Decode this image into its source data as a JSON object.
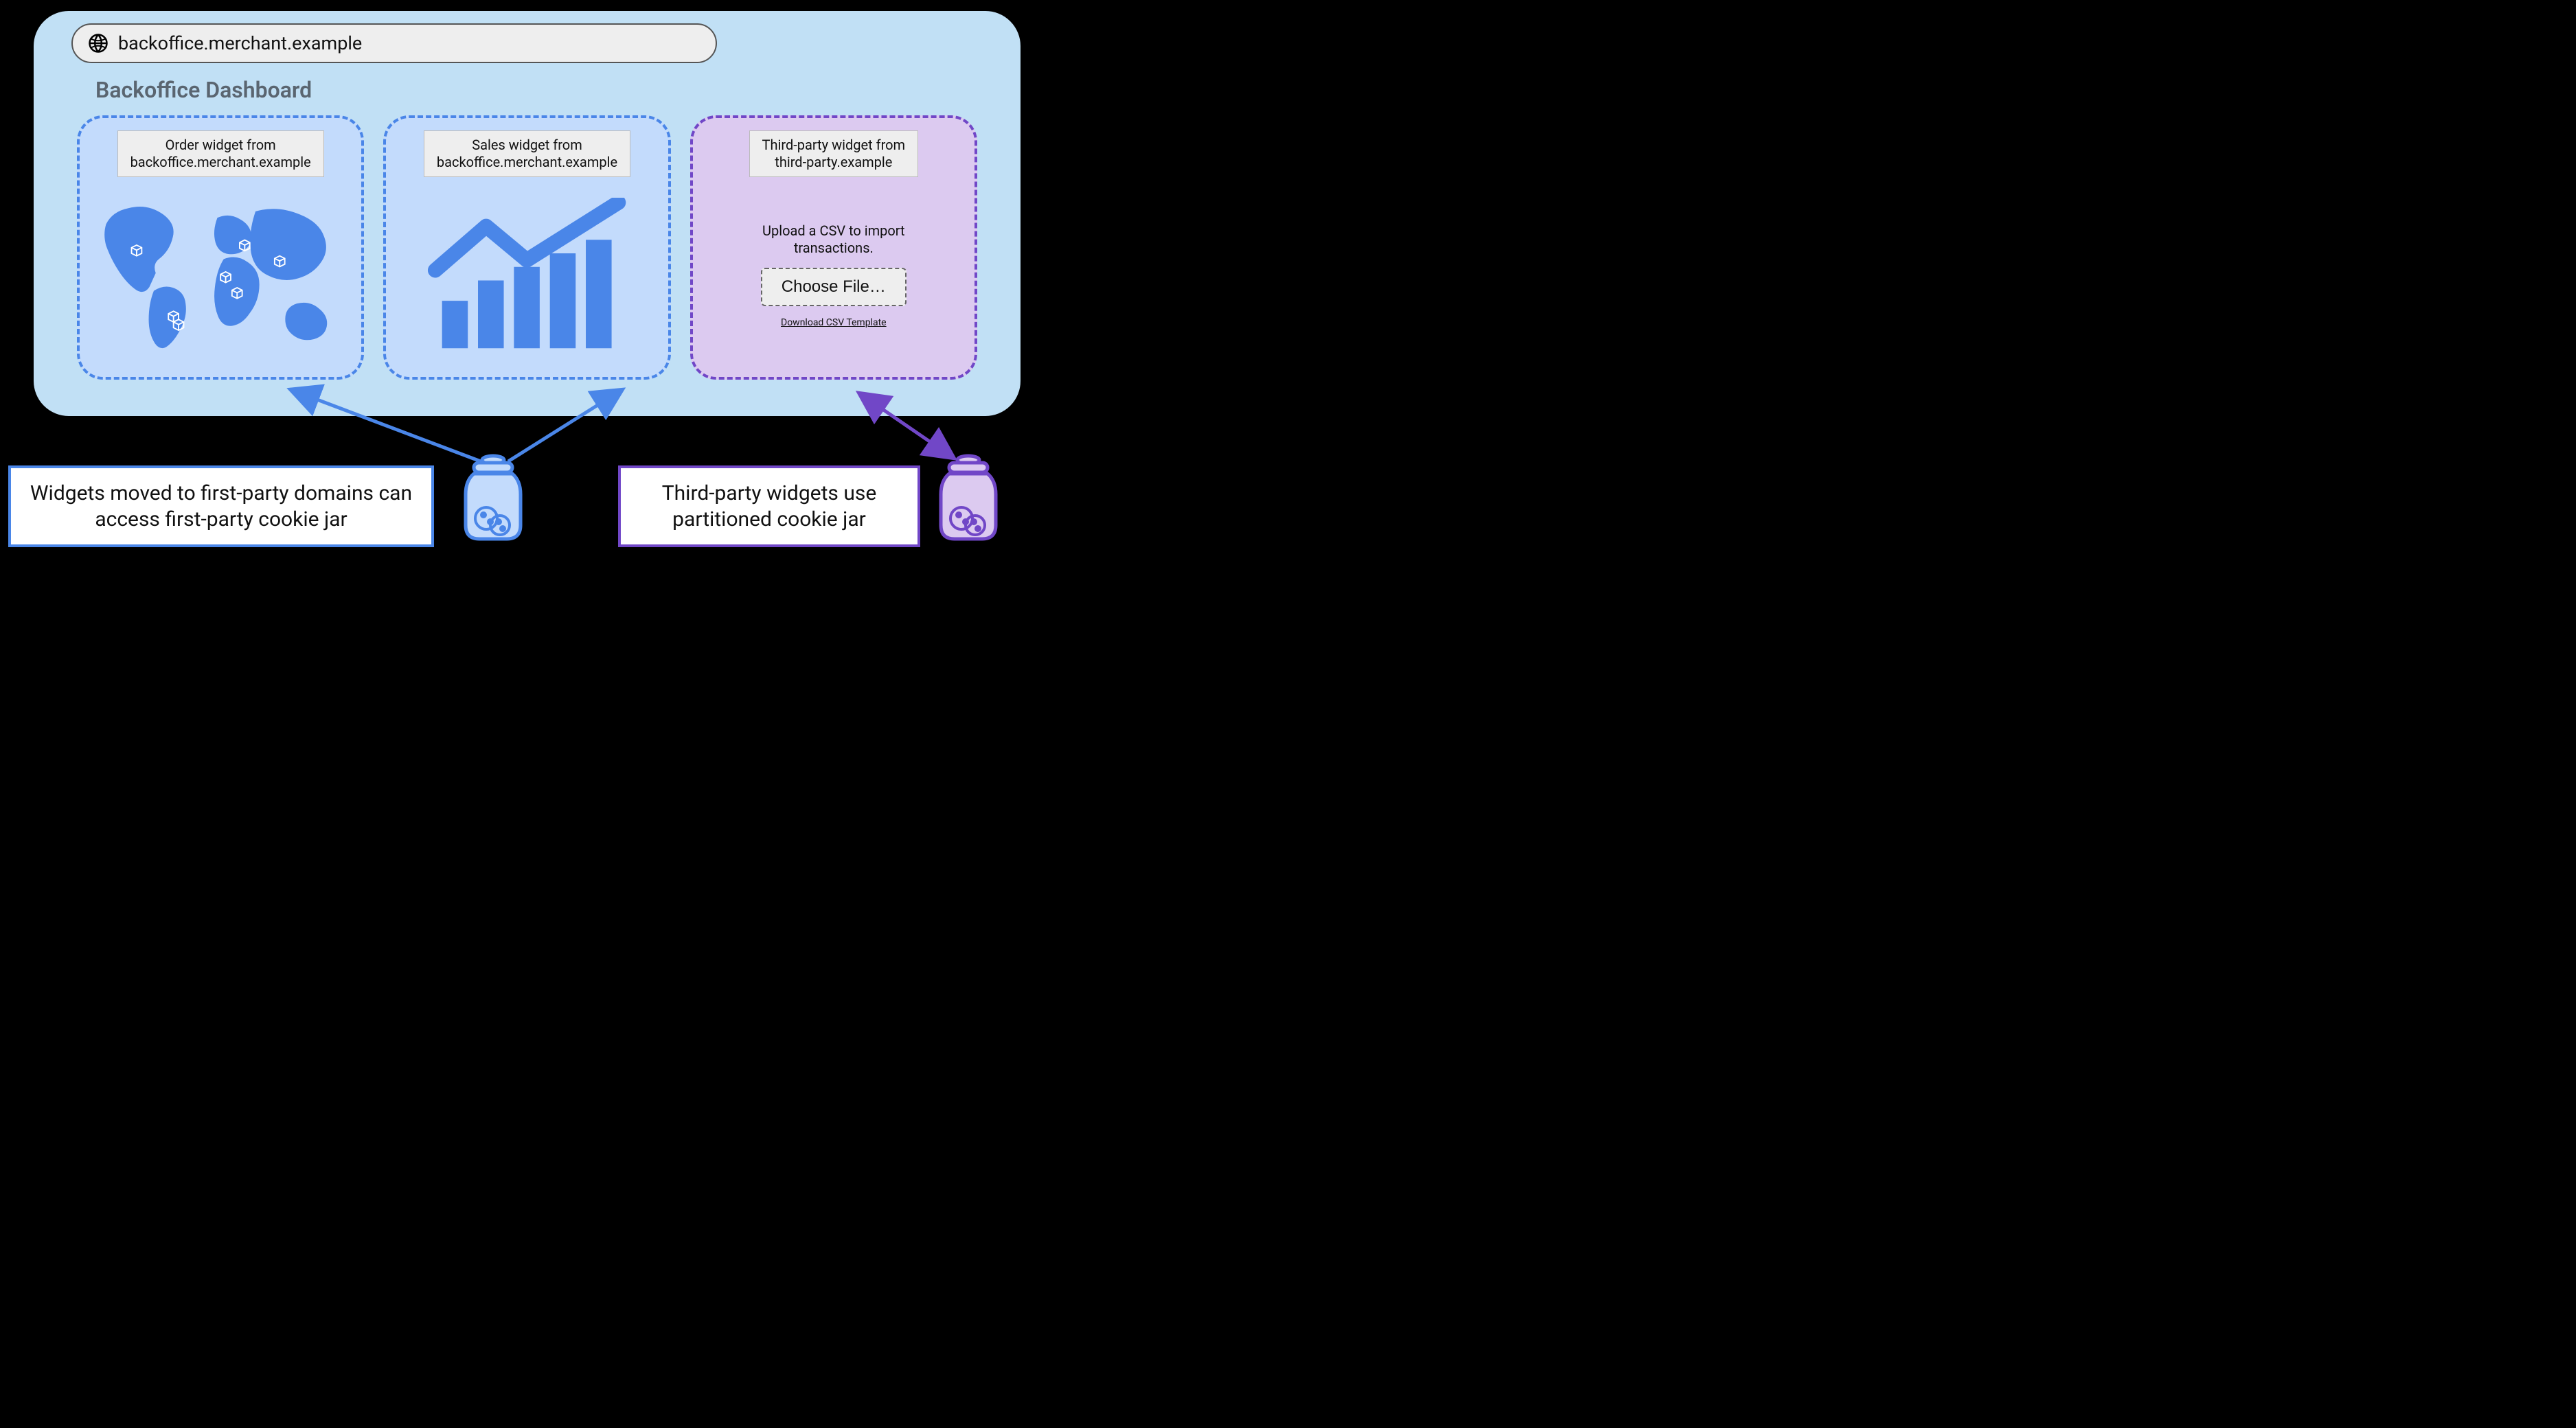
{
  "address_bar": {
    "url": "backoffice.merchant.example"
  },
  "page": {
    "title": "Backoffice Dashboard"
  },
  "widgets": {
    "order": {
      "label": "Order widget from\nbackoffice.merchant.example"
    },
    "sales": {
      "label": "Sales widget from\nbackoffice.merchant.example"
    },
    "thirdparty": {
      "label": "Third-party widget from\nthird-party.example",
      "instruction": "Upload a CSV to import transactions.",
      "choose_file": "Choose File…",
      "download_template": "Download CSV Template"
    }
  },
  "captions": {
    "first_party": "Widgets moved to first-party domains can access first-party cookie jar",
    "third_party": "Third-party widgets use partitioned cookie jar"
  },
  "colors": {
    "fp_accent": "#4a86e8",
    "tp_accent": "#7147c7"
  }
}
